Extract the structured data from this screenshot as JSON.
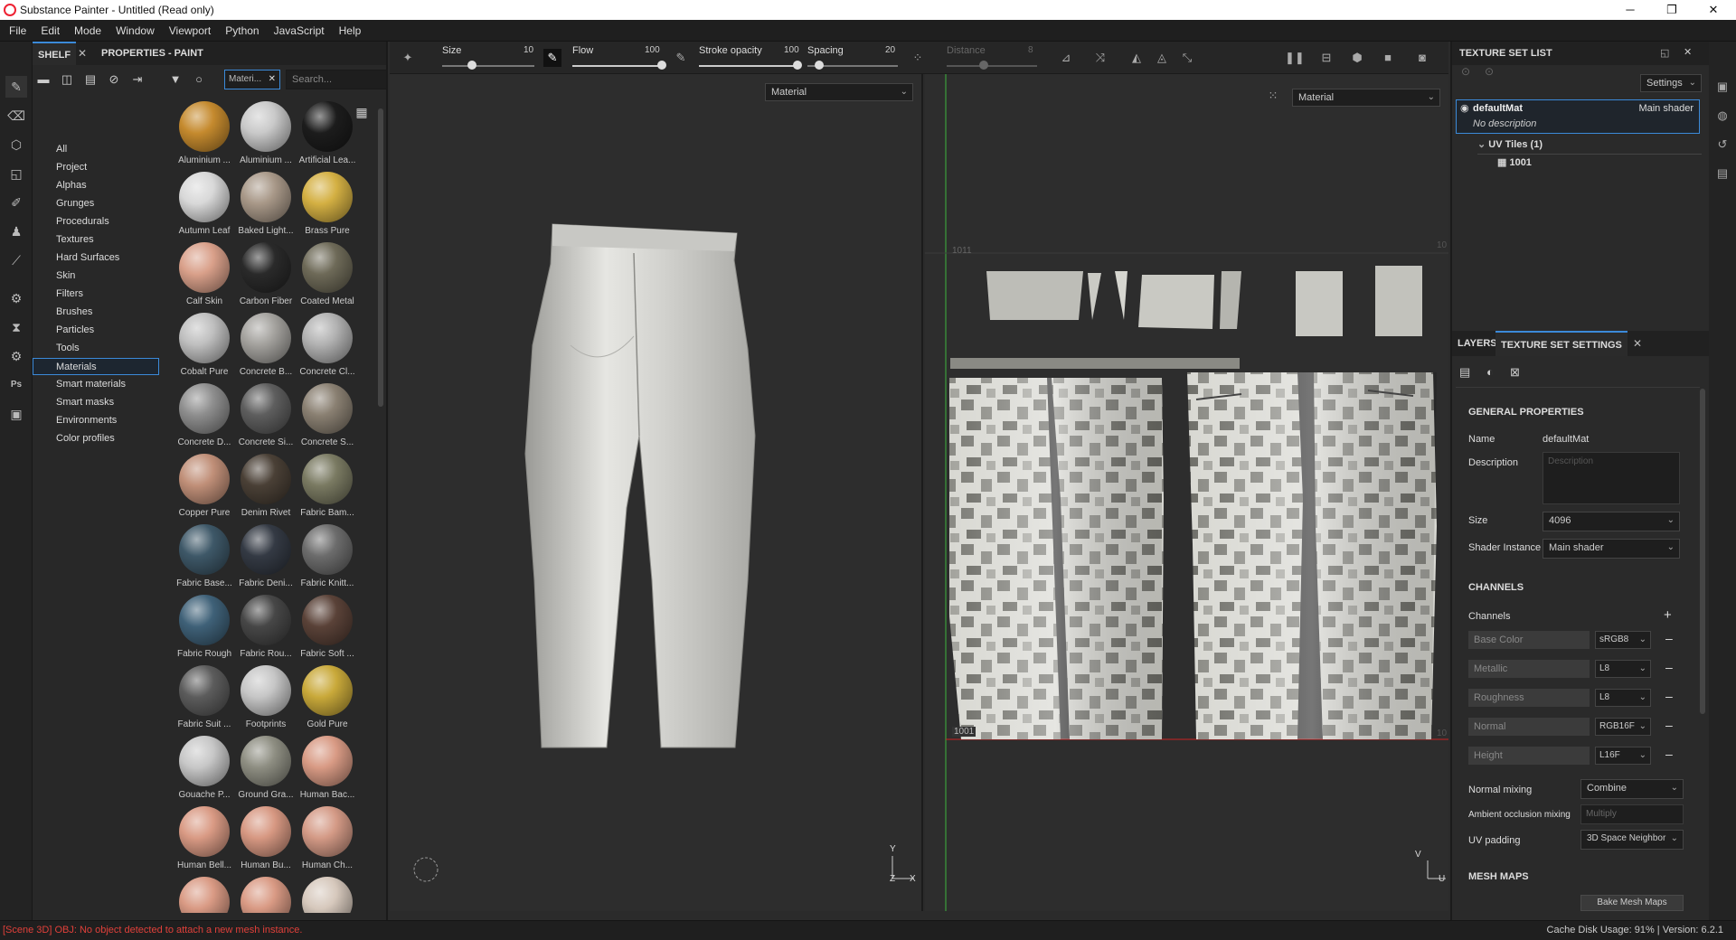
{
  "window": {
    "title": "Substance Painter - Untitled (Read only)",
    "minimize": "─",
    "maximize": "❐",
    "close": "✕"
  },
  "menu": [
    "File",
    "Edit",
    "Mode",
    "Window",
    "Viewport",
    "Python",
    "JavaScript",
    "Help"
  ],
  "shelf": {
    "tab_shelf": "SHELF",
    "tab_properties": "PROPERTIES - PAINT",
    "filter_tag": "Materi...",
    "search_placeholder": "Search...",
    "categories": [
      "All",
      "Project",
      "Alphas",
      "Grunges",
      "Procedurals",
      "Textures",
      "Hard Surfaces",
      "Skin",
      "Filters",
      "Brushes",
      "Particles",
      "Tools",
      "Materials",
      "Smart materials",
      "Smart masks",
      "Environments",
      "Color profiles"
    ],
    "selected_category": "Materials",
    "materials": [
      {
        "label": "Aluminium ...",
        "color": "#c58a2e"
      },
      {
        "label": "Aluminium ...",
        "color": "#c9c9c9"
      },
      {
        "label": "Artificial Lea...",
        "color": "#1c1c1c"
      },
      {
        "label": "Autumn Leaf",
        "color": "#d8d8d8"
      },
      {
        "label": "Baked Light...",
        "color": "#a89888"
      },
      {
        "label": "Brass Pure",
        "color": "#d4b043"
      },
      {
        "label": "Calf Skin",
        "color": "#d9a08a"
      },
      {
        "label": "Carbon Fiber",
        "color": "#2a2a2a"
      },
      {
        "label": "Coated Metal",
        "color": "#6e6a58"
      },
      {
        "label": "Cobalt Pure",
        "color": "#bfbfbf"
      },
      {
        "label": "Concrete B...",
        "color": "#a4a29e"
      },
      {
        "label": "Concrete Cl...",
        "color": "#b2b2b2"
      },
      {
        "label": "Concrete D...",
        "color": "#8e8e8e"
      },
      {
        "label": "Concrete Si...",
        "color": "#5e5e5e"
      },
      {
        "label": "Concrete S...",
        "color": "#8a8072"
      },
      {
        "label": "Copper Pure",
        "color": "#c08f78"
      },
      {
        "label": "Denim Rivet",
        "color": "#4a4036"
      },
      {
        "label": "Fabric Bam...",
        "color": "#7a7a62"
      },
      {
        "label": "Fabric Base...",
        "color": "#3e5868"
      },
      {
        "label": "Fabric Deni...",
        "color": "#343a44"
      },
      {
        "label": "Fabric Knitt...",
        "color": "#6c6c6c"
      },
      {
        "label": "Fabric Rough",
        "color": "#3f6178"
      },
      {
        "label": "Fabric Rou...",
        "color": "#474747"
      },
      {
        "label": "Fabric Soft ...",
        "color": "#5a4238"
      },
      {
        "label": "Fabric Suit ...",
        "color": "#5c5c5c"
      },
      {
        "label": "Footprints",
        "color": "#c6c6c6"
      },
      {
        "label": "Gold Pure",
        "color": "#c9a93a"
      },
      {
        "label": "Gouache P...",
        "color": "#c7c7c7"
      },
      {
        "label": "Ground Gra...",
        "color": "#8e8e82"
      },
      {
        "label": "Human Bac...",
        "color": "#d89a84"
      },
      {
        "label": "Human Bell...",
        "color": "#d99a84"
      },
      {
        "label": "Human Bu...",
        "color": "#d79882"
      },
      {
        "label": "Human Ch...",
        "color": "#d49a86"
      },
      {
        "label": "",
        "color": "#d99a84"
      },
      {
        "label": "",
        "color": "#d99a84"
      },
      {
        "label": "",
        "color": "#d6c8bc"
      }
    ]
  },
  "toolbar": {
    "size_label": "Size",
    "size_value": "10",
    "flow_label": "Flow",
    "flow_value": "100",
    "opacity_label": "Stroke opacity",
    "opacity_value": "100",
    "spacing_label": "Spacing",
    "spacing_value": "20",
    "distance_label": "Distance",
    "distance_value": "8"
  },
  "viewport3d": {
    "dropdown": "Material",
    "axis_y": "Y",
    "axis_z": "Z",
    "axis_x": "X"
  },
  "viewport2d": {
    "dropdown": "Material",
    "tile_top": "1011",
    "tile_bottom": "1001",
    "tile_right_top": "10",
    "tile_right_bottom": "10",
    "axis_v": "V",
    "axis_u": "U"
  },
  "texture_set_list": {
    "title": "TEXTURE SET LIST",
    "settings": "Settings",
    "material_name": "defaultMat",
    "shader": "Main shader",
    "description": "No description",
    "uv_tiles": "UV Tiles (1)",
    "tile": "1001"
  },
  "texture_set_settings": {
    "tab_layers": "LAYERS",
    "tab_settings": "TEXTURE SET SETTINGS",
    "general": "GENERAL PROPERTIES",
    "name_label": "Name",
    "name_value": "defaultMat",
    "desc_label": "Description",
    "desc_placeholder": "Description",
    "size_label": "Size",
    "size_value": "4096",
    "shader_label": "Shader Instance",
    "shader_value": "Main shader",
    "channels_title": "CHANNELS",
    "channels_label": "Channels",
    "channels": [
      {
        "name": "Base Color",
        "format": "sRGB8"
      },
      {
        "name": "Metallic",
        "format": "L8"
      },
      {
        "name": "Roughness",
        "format": "L8"
      },
      {
        "name": "Normal",
        "format": "RGB16F"
      },
      {
        "name": "Height",
        "format": "L16F"
      }
    ],
    "normal_mixing_label": "Normal mixing",
    "normal_mixing_value": "Combine",
    "ao_mixing_label": "Ambient occlusion mixing",
    "ao_mixing_value": "Multiply",
    "uv_padding_label": "UV padding",
    "uv_padding_value": "3D Space Neighbor",
    "mesh_maps": "MESH MAPS",
    "bake_button": "Bake Mesh Maps"
  },
  "status": {
    "error": "[Scene 3D] OBJ: No object detected to attach a new mesh instance.",
    "info": "Cache Disk Usage:  91% | Version: 6.2.1"
  }
}
